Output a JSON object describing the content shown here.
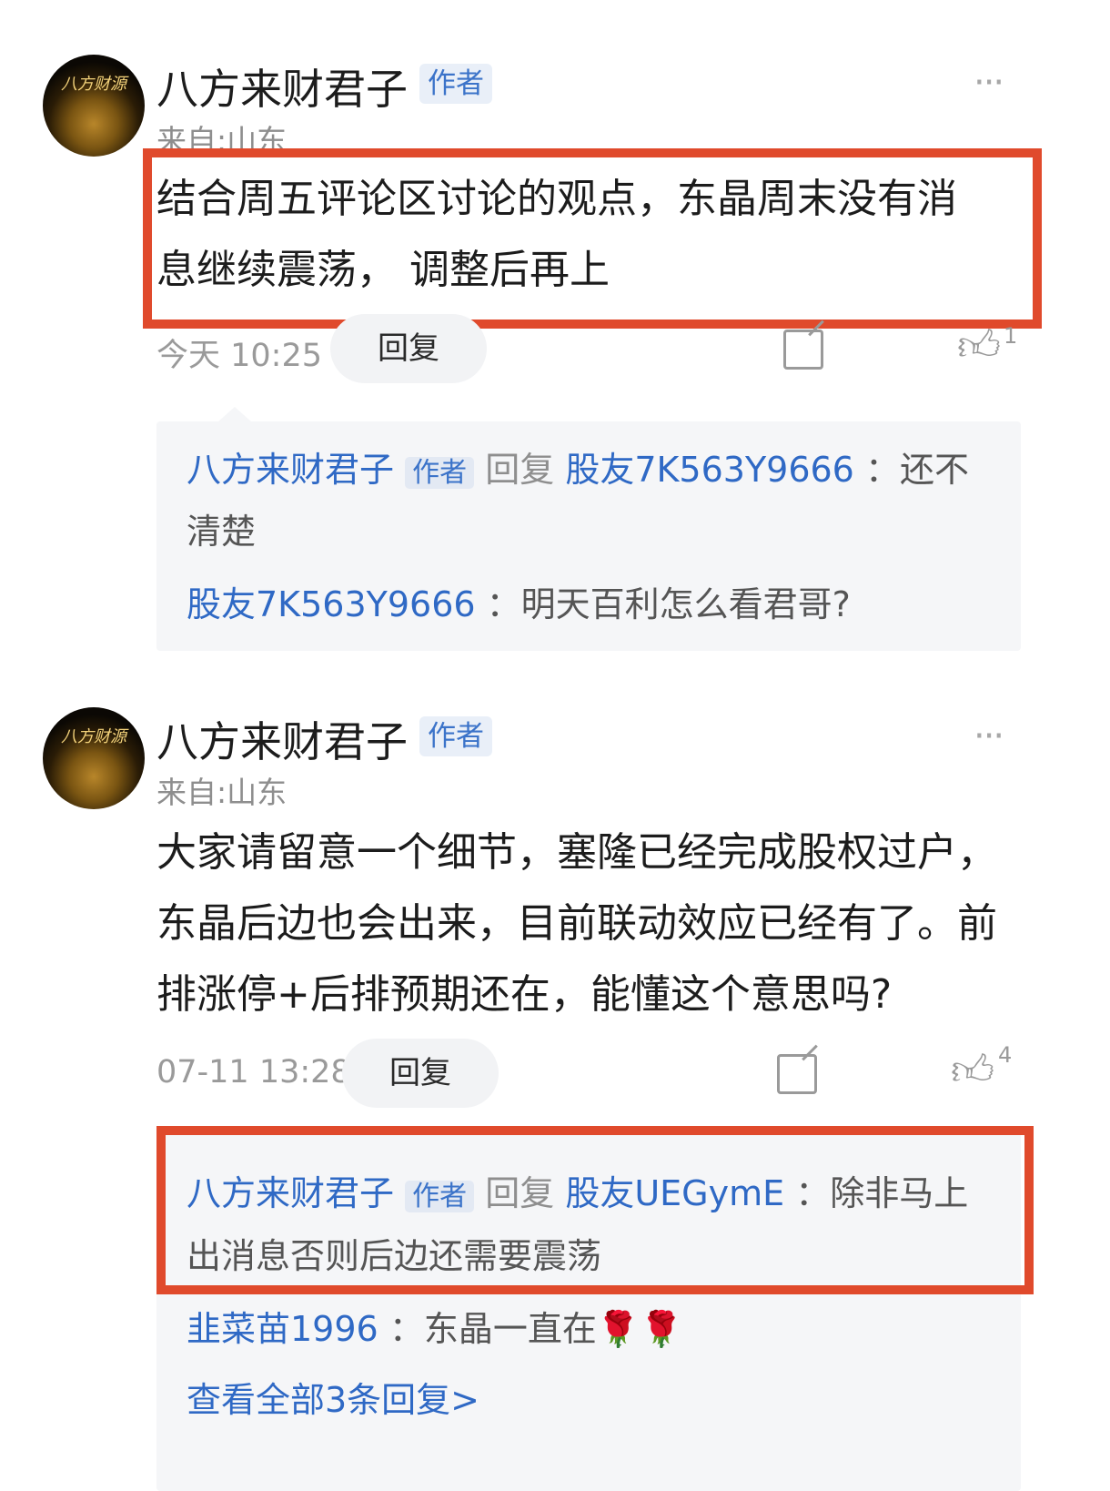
{
  "comments": [
    {
      "author": "八方来财君子",
      "badge": "作者",
      "avatar_text": "八方财源",
      "location": "来自:山东",
      "text_line1": "结合周五评论区讨论的观点，东晶周末没有消",
      "text_line2": "息继续震荡， 调整后再上",
      "time": "今天 10:25",
      "reply_label": "回复",
      "like_count": "1",
      "more": "···",
      "thread": {
        "r1_author": "八方来财君子",
        "r1_badge": "作者",
        "r1_reply_word": "回复",
        "r1_target": "股友7K563Y9666",
        "r1_text_a": "：还不",
        "r1_text_b": "清楚",
        "r2_author": "股友7K563Y9666",
        "r2_text": "：明天百利怎么看君哥?"
      }
    },
    {
      "author": "八方来财君子",
      "badge": "作者",
      "avatar_text": "八方财源",
      "location": "来自:山东",
      "text_line1": "大家请留意一个细节，塞隆已经完成股权过户，",
      "text_line2": "东晶后边也会出来，目前联动效应已经有了。前",
      "text_line3": "排涨停+后排预期还在，能懂这个意思吗?",
      "time": "07-11 13:28",
      "reply_label": "回复",
      "like_count": "4",
      "more": "···",
      "thread": {
        "r1_author": "八方来财君子",
        "r1_badge": "作者",
        "r1_reply_word": "回复",
        "r1_target": "股友UEGymE",
        "r1_text_a": "：除非马上",
        "r1_text_b": "出消息否则后边还需要震荡",
        "r2_author": "韭菜苗1996",
        "r2_text": "：东晶一直在🌹🌹",
        "view_all": "查看全部3条回复>"
      }
    }
  ]
}
